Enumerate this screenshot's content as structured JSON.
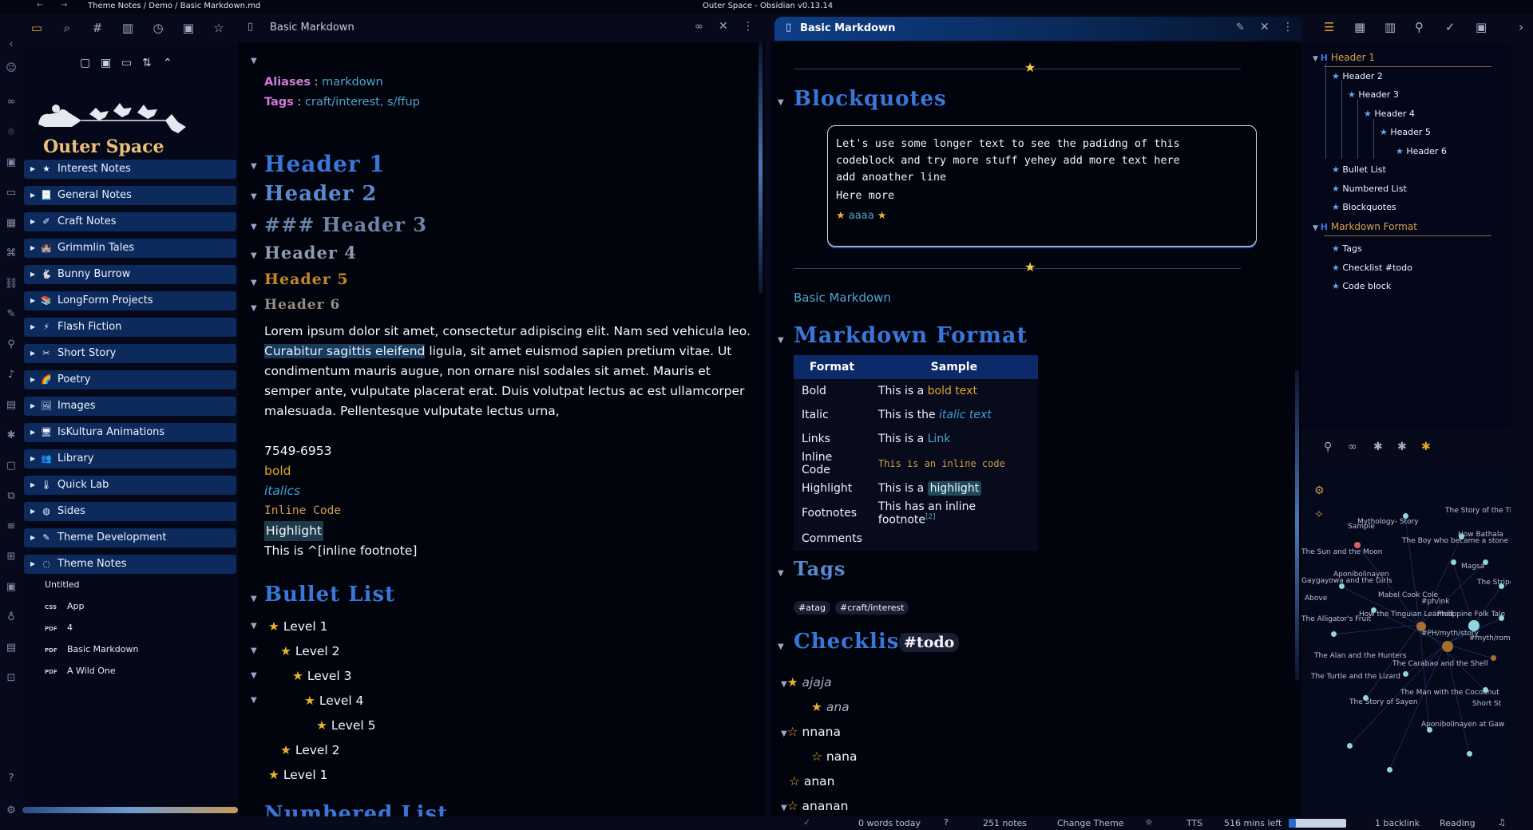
{
  "window": {
    "breadcrumb": "Theme Notes / Demo / Basic Markdown.md",
    "title": "Outer Space - Obsidian v0.13.14"
  },
  "left": {
    "logo_text": "Outer Space",
    "folders": [
      {
        "icon": "★",
        "label": "Interest Notes"
      },
      {
        "icon": "📃",
        "label": "General Notes"
      },
      {
        "icon": "✐",
        "label": "Craft Notes"
      },
      {
        "icon": "🏰",
        "label": "Grimmlin Tales"
      },
      {
        "icon": "🐇",
        "label": "Bunny Burrow"
      },
      {
        "icon": "📚",
        "label": "LongForm Projects"
      },
      {
        "icon": "⚡",
        "label": "Flash Fiction"
      },
      {
        "icon": "✂",
        "label": "Short Story"
      },
      {
        "icon": "🌈",
        "label": "Poetry"
      },
      {
        "icon": "🖼",
        "label": "Images"
      },
      {
        "icon": "🖥",
        "label": "IsKultura Animations"
      },
      {
        "icon": "👥",
        "label": "Library"
      },
      {
        "icon": "🌡",
        "label": "Quick Lab"
      },
      {
        "icon": "◍",
        "label": "Sides"
      },
      {
        "icon": "✎",
        "label": "Theme Development"
      },
      {
        "icon": "◌",
        "label": "Theme Notes"
      }
    ],
    "files": [
      {
        "tag": "",
        "label": "Untitled"
      },
      {
        "tag": "CSS",
        "label": "App"
      },
      {
        "tag": "PDF",
        "label": "4"
      },
      {
        "tag": "PDF",
        "label": "Basic Markdown"
      },
      {
        "tag": "PDF",
        "label": "A Wild One"
      }
    ]
  },
  "pane1": {
    "tab_title": "Basic Markdown",
    "aliases_key": "Aliases",
    "aliases_sep": " : ",
    "aliases_val": "markdown",
    "tags_key": "Tags",
    "tags_sep": " : ",
    "tags_val": "craft/interest, s/ffup",
    "h1": "Header 1",
    "h2": "Header 2",
    "h3": "### Header 3",
    "h4": "Header 4",
    "h5": "Header 5",
    "h6": "Header 6",
    "para_hl": "Curabitur sagittis eleifend",
    "para_line1": "Lorem ipsum dolor sit amet, consectetur adipiscing elit. Nam sed vehicula leo.",
    "para_line2": " ligula, sit amet euismod sapien pretium vitae. Ut",
    "para_line3": "condimentum mauris augue, non ornare nisl sodales sit amet. Mauris et",
    "para_line4": "semper ante, vulputate placerat erat. Duis volutpat lectus ac est ullamcorper",
    "para_line5": "malesuada. Pellentesque vulputate lectus urna,",
    "phone": "7549-6953",
    "bold": "bold",
    "italics": "italics",
    "code": "Inline Code",
    "highlight": "Highlight",
    "footnote": "This is ^[inline footnote]",
    "bullet_title": "Bullet List",
    "bullets": [
      {
        "label": "Level 1",
        "indent": 0
      },
      {
        "label": "Level 2",
        "indent": 1
      },
      {
        "label": "Level 3",
        "indent": 2
      },
      {
        "label": "Level 4",
        "indent": 3
      },
      {
        "label": "Level 5",
        "indent": 4
      },
      {
        "label": "Level 2",
        "indent": 1
      },
      {
        "label": "Level 1",
        "indent": 0
      }
    ],
    "numbered_title": "Numbered List"
  },
  "pane2": {
    "tab_title": "Basic Markdown",
    "blockquotes_title": "Blockquotes",
    "code_lines": [
      "Let's use some longer text to see the padidng of this",
      "codeblock and try more stuff yehey add more text here",
      "add anoather line"
    ],
    "code_more": "Here more",
    "code_link": "aaaa",
    "basic_link": "Basic Markdown",
    "format_title": "Markdown Format",
    "table_headers": [
      "Format",
      "Sample"
    ],
    "table_rows": [
      {
        "format": "Bold",
        "prefix": "This is a ",
        "value": "bold text"
      },
      {
        "format": "Italic",
        "prefix": "This is the ",
        "value": "italic text"
      },
      {
        "format": "Links",
        "prefix": "This is a ",
        "value": "Link"
      },
      {
        "format": "Inline Code",
        "prefix": "",
        "value": "This is an inline code"
      },
      {
        "format": "Highlight",
        "prefix": "This is a ",
        "value": "highlight"
      },
      {
        "format": "Footnotes",
        "prefix": "This has an inline footnote",
        "value": "[2]"
      },
      {
        "format": "Comments",
        "prefix": "",
        "value": ""
      }
    ],
    "tags_title": "Tags",
    "tags": [
      "#atag",
      "#craft/interest"
    ],
    "checklist_title": "Checklist",
    "checklist_tag": "#todo",
    "checklist": [
      {
        "label": "ajaja",
        "done": true,
        "indent": 0
      },
      {
        "label": "ana",
        "done": true,
        "indent": 1
      },
      {
        "label": "nnana",
        "done": false,
        "indent": 0
      },
      {
        "label": "nana",
        "done": false,
        "indent": 1
      },
      {
        "label": "anan",
        "done": false,
        "indent": 0
      },
      {
        "label": "ananan",
        "done": false,
        "indent": 0
      }
    ]
  },
  "outline": {
    "items": [
      {
        "label": "Header 1",
        "level": 0,
        "kind": "h"
      },
      {
        "label": "Header 2",
        "level": 1,
        "kind": "s"
      },
      {
        "label": "Header 3",
        "level": 2,
        "kind": "s"
      },
      {
        "label": "Header 4",
        "level": 3,
        "kind": "s"
      },
      {
        "label": "Header 5",
        "level": 4,
        "kind": "s"
      },
      {
        "label": "Header 6",
        "level": 5,
        "kind": "s"
      },
      {
        "label": "Bullet List",
        "level": 1,
        "kind": "s"
      },
      {
        "label": "Numbered List",
        "level": 1,
        "kind": "s"
      },
      {
        "label": "Blockquotes",
        "level": 1,
        "kind": "s"
      },
      {
        "label": "Markdown Format",
        "level": 0,
        "kind": "h"
      },
      {
        "label": "Tags",
        "level": 1,
        "kind": "s"
      },
      {
        "label": "Checklist #todo",
        "level": 1,
        "kind": "s"
      },
      {
        "label": "Code block",
        "level": 1,
        "kind": "s"
      }
    ]
  },
  "graph": {
    "labels": [
      "Mythology- Story",
      "The Story of the Tiger",
      "Sample",
      "How Bathala",
      "The Sun and the Moon",
      "The Boy who became a stone",
      "Gaygayowa and the Girls",
      "Aponibolinayen",
      "Magsa",
      "The Stripe",
      "Mabel Cook Cole",
      "#ph/ink",
      "The Alligator's Fruit",
      "How the Tinguian Learned",
      "Philippine Folk Tale",
      "#PH/myth/story",
      "#myth/roma",
      "The Alan and the Hunters",
      "The Carabao and the Shell",
      "The Turtle and the Lizard",
      "The Man with the Cocoanut",
      "The Story of Sayen",
      "Short St",
      "Aponibolinayen at Gaw",
      "Above"
    ]
  },
  "status": {
    "words": "0 words today",
    "notes": "251 notes",
    "theme": "Change Theme",
    "tts": "TTS",
    "mins": "516 mins left",
    "backlink": "1 backlink",
    "mode": "Reading"
  },
  "colors": {
    "accent_blue": "#3a76d8",
    "header5": "#c4882a",
    "folder_bg": "#0c2a5c",
    "link": "#4fa3c9",
    "tag_pink": "#d17bd6"
  }
}
